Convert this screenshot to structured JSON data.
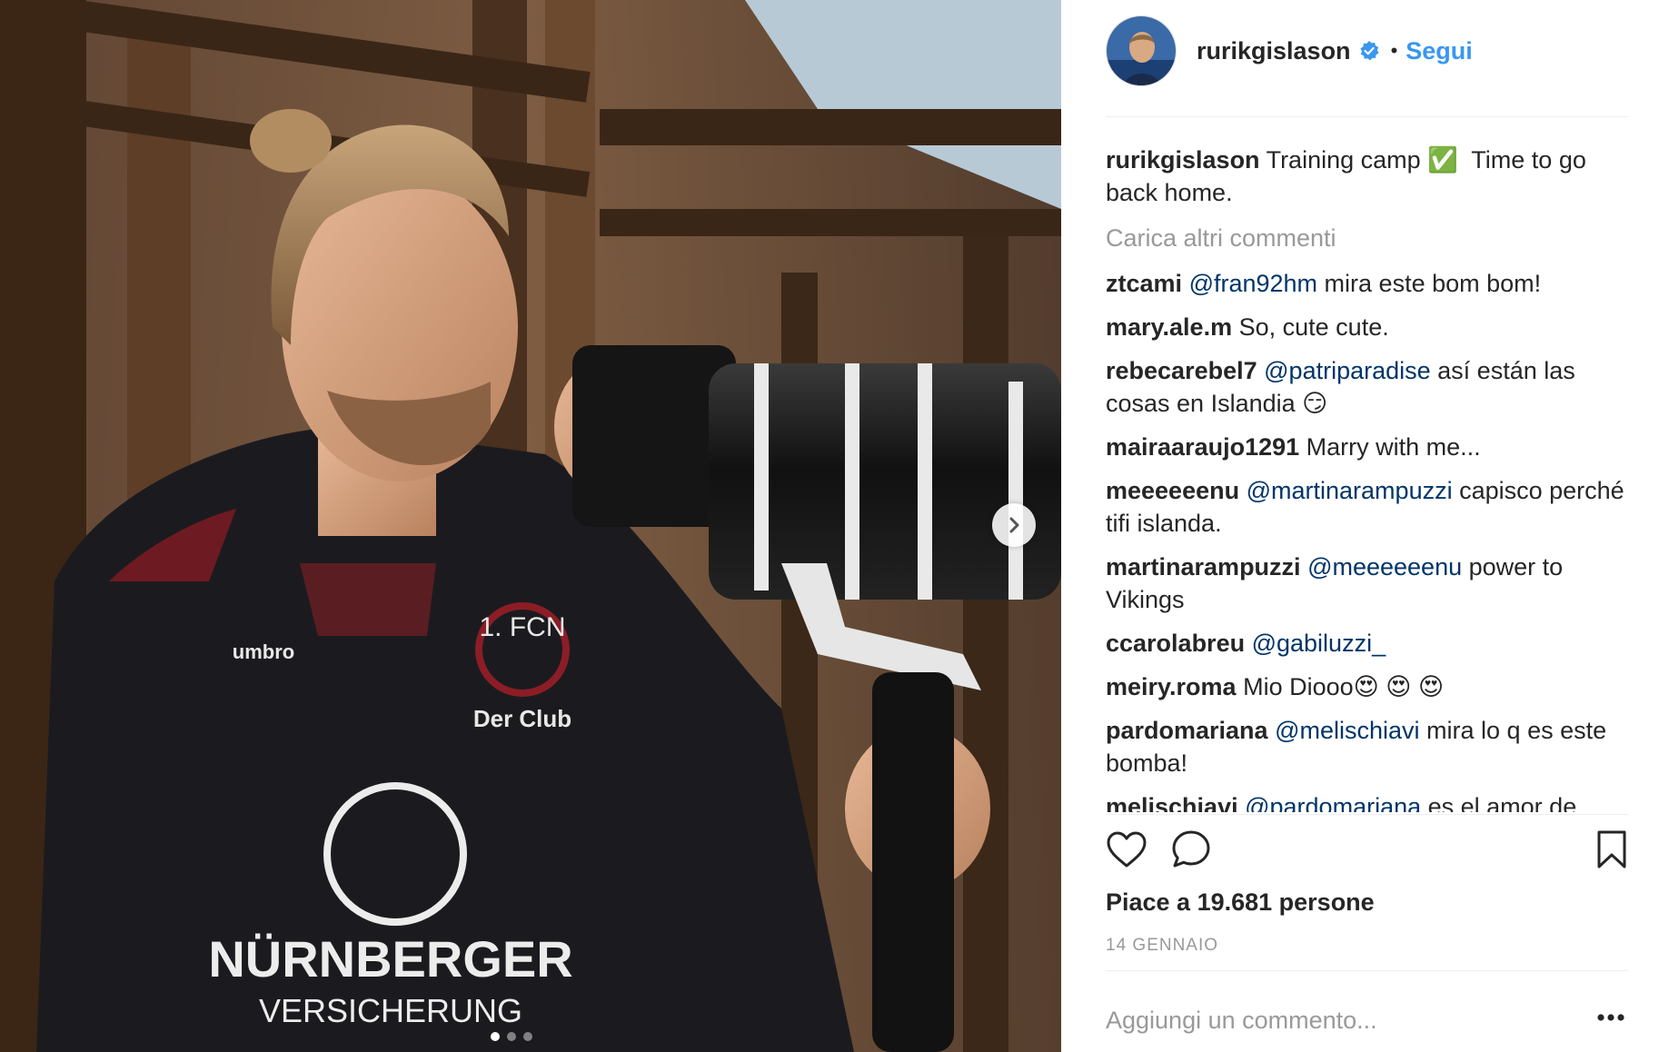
{
  "post": {
    "author": "rurikgislason",
    "verified": true,
    "follow_label": "Segui",
    "separator": "•",
    "caption": {
      "user": "rurikgislason",
      "text_before": "Training camp",
      "emoji": "✅",
      "text_after": "  Time to go back home."
    },
    "load_more": "Carica altri commenti",
    "comments": [
      {
        "user": "ztcami",
        "mention": "@fran92hm",
        "text": " mira este bom bom!"
      },
      {
        "user": "mary.ale.m",
        "mention": "",
        "text": "So, cute cute."
      },
      {
        "user": "rebecarebel7",
        "mention": "@patriparadise",
        "text": " así están las cosas en Islandia 😏"
      },
      {
        "user": "mairaaraujo1291",
        "mention": "",
        "text": "Marry with me..."
      },
      {
        "user": "meeeeeenu",
        "mention": "@martinarampuzzi",
        "text": " capisco perché tifi islanda."
      },
      {
        "user": "martinarampuzzi",
        "mention": "@meeeeeenu",
        "text": " power to Vikings"
      },
      {
        "user": "ccarolabreu",
        "mention": "@gabiluzzi_",
        "text": ""
      },
      {
        "user": "meiry.roma",
        "mention": "",
        "text": "Mio Diooo😍 😍 😍"
      },
      {
        "user": "pardomariana",
        "mention": "@melischiavi",
        "text": " mira lo q es este bomba!"
      },
      {
        "user": "melischiavi",
        "mention": "@pardomariana",
        "text": " es el amor de"
      }
    ],
    "likes": "Piace a 19.681 persone",
    "date": "14 GENNAIO",
    "add_comment_placeholder": "Aggiungi un commento...",
    "carousel": {
      "count": 3,
      "active": 0
    }
  },
  "photo": {
    "jacket_print": "NÜRNBERGER",
    "jacket_print_2": "VERSICHERUNG",
    "club_badge": "1. FCN",
    "club_name": "Der Club",
    "brand": "umbro"
  },
  "icons": [
    "heart-icon",
    "comment-icon",
    "bookmark-icon",
    "verified-badge-icon",
    "more-options-icon",
    "chevron-right-icon"
  ],
  "colors": {
    "link": "#3897f0",
    "mention": "#003569",
    "muted": "#999999",
    "text": "#262626",
    "verified": "#3897f0"
  }
}
